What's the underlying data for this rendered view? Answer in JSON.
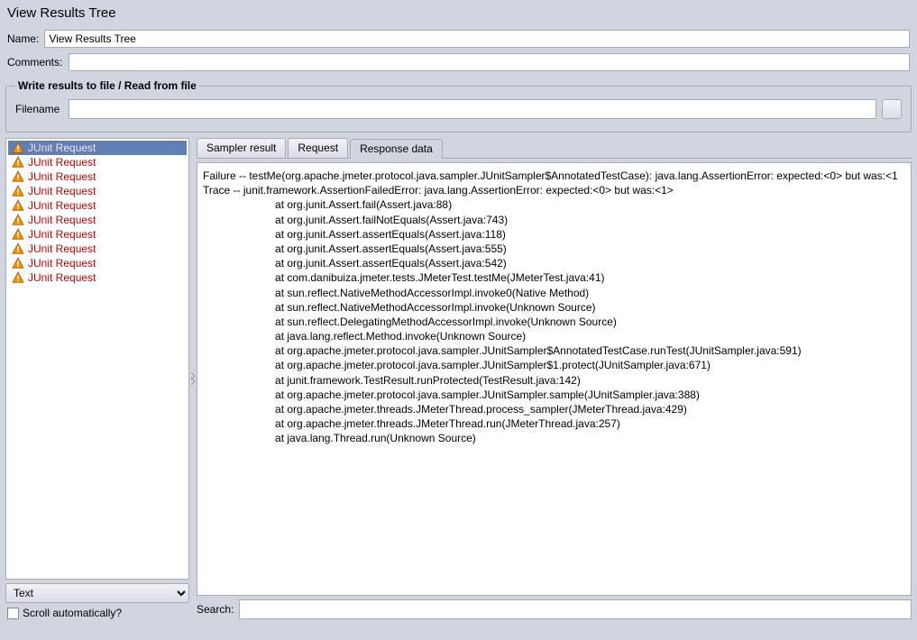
{
  "title": "View Results Tree",
  "nameLabel": "Name:",
  "nameValue": "View Results Tree",
  "commentsLabel": "Comments:",
  "commentsValue": "",
  "fileSectionTitle": "Write results to file / Read from file",
  "filenameLabel": "Filename",
  "filenameValue": "",
  "treeItems": [
    {
      "label": "JUnit Request",
      "selected": true
    },
    {
      "label": "JUnit Request",
      "selected": false
    },
    {
      "label": "JUnit Request",
      "selected": false
    },
    {
      "label": "JUnit Request",
      "selected": false
    },
    {
      "label": "JUnit Request",
      "selected": false
    },
    {
      "label": "JUnit Request",
      "selected": false
    },
    {
      "label": "JUnit Request",
      "selected": false
    },
    {
      "label": "JUnit Request",
      "selected": false
    },
    {
      "label": "JUnit Request",
      "selected": false
    },
    {
      "label": "JUnit Request",
      "selected": false
    }
  ],
  "viewSelect": "Text",
  "scrollCheckboxLabel": "Scroll automatically?",
  "tabs": [
    {
      "label": "Sampler result",
      "active": false
    },
    {
      "label": "Request",
      "active": false
    },
    {
      "label": "Response data",
      "active": true
    }
  ],
  "responseBody": "Failure -- testMe(org.apache.jmeter.protocol.java.sampler.JUnitSampler$AnnotatedTestCase): java.lang.AssertionError: expected:<0> but was:<1\nTrace -- junit.framework.AssertionFailedError: java.lang.AssertionError: expected:<0> but was:<1>\n                        at org.junit.Assert.fail(Assert.java:88)\n                        at org.junit.Assert.failNotEquals(Assert.java:743)\n                        at org.junit.Assert.assertEquals(Assert.java:118)\n                        at org.junit.Assert.assertEquals(Assert.java:555)\n                        at org.junit.Assert.assertEquals(Assert.java:542)\n                        at com.danibuiza.jmeter.tests.JMeterTest.testMe(JMeterTest.java:41)\n                        at sun.reflect.NativeMethodAccessorImpl.invoke0(Native Method)\n                        at sun.reflect.NativeMethodAccessorImpl.invoke(Unknown Source)\n                        at sun.reflect.DelegatingMethodAccessorImpl.invoke(Unknown Source)\n                        at java.lang.reflect.Method.invoke(Unknown Source)\n                        at org.apache.jmeter.protocol.java.sampler.JUnitSampler$AnnotatedTestCase.runTest(JUnitSampler.java:591)\n                        at org.apache.jmeter.protocol.java.sampler.JUnitSampler$1.protect(JUnitSampler.java:671)\n                        at junit.framework.TestResult.runProtected(TestResult.java:142)\n                        at org.apache.jmeter.protocol.java.sampler.JUnitSampler.sample(JUnitSampler.java:388)\n                        at org.apache.jmeter.threads.JMeterThread.process_sampler(JMeterThread.java:429)\n                        at org.apache.jmeter.threads.JMeterThread.run(JMeterThread.java:257)\n                        at java.lang.Thread.run(Unknown Source)\n",
  "searchLabel": "Search:",
  "searchValue": ""
}
